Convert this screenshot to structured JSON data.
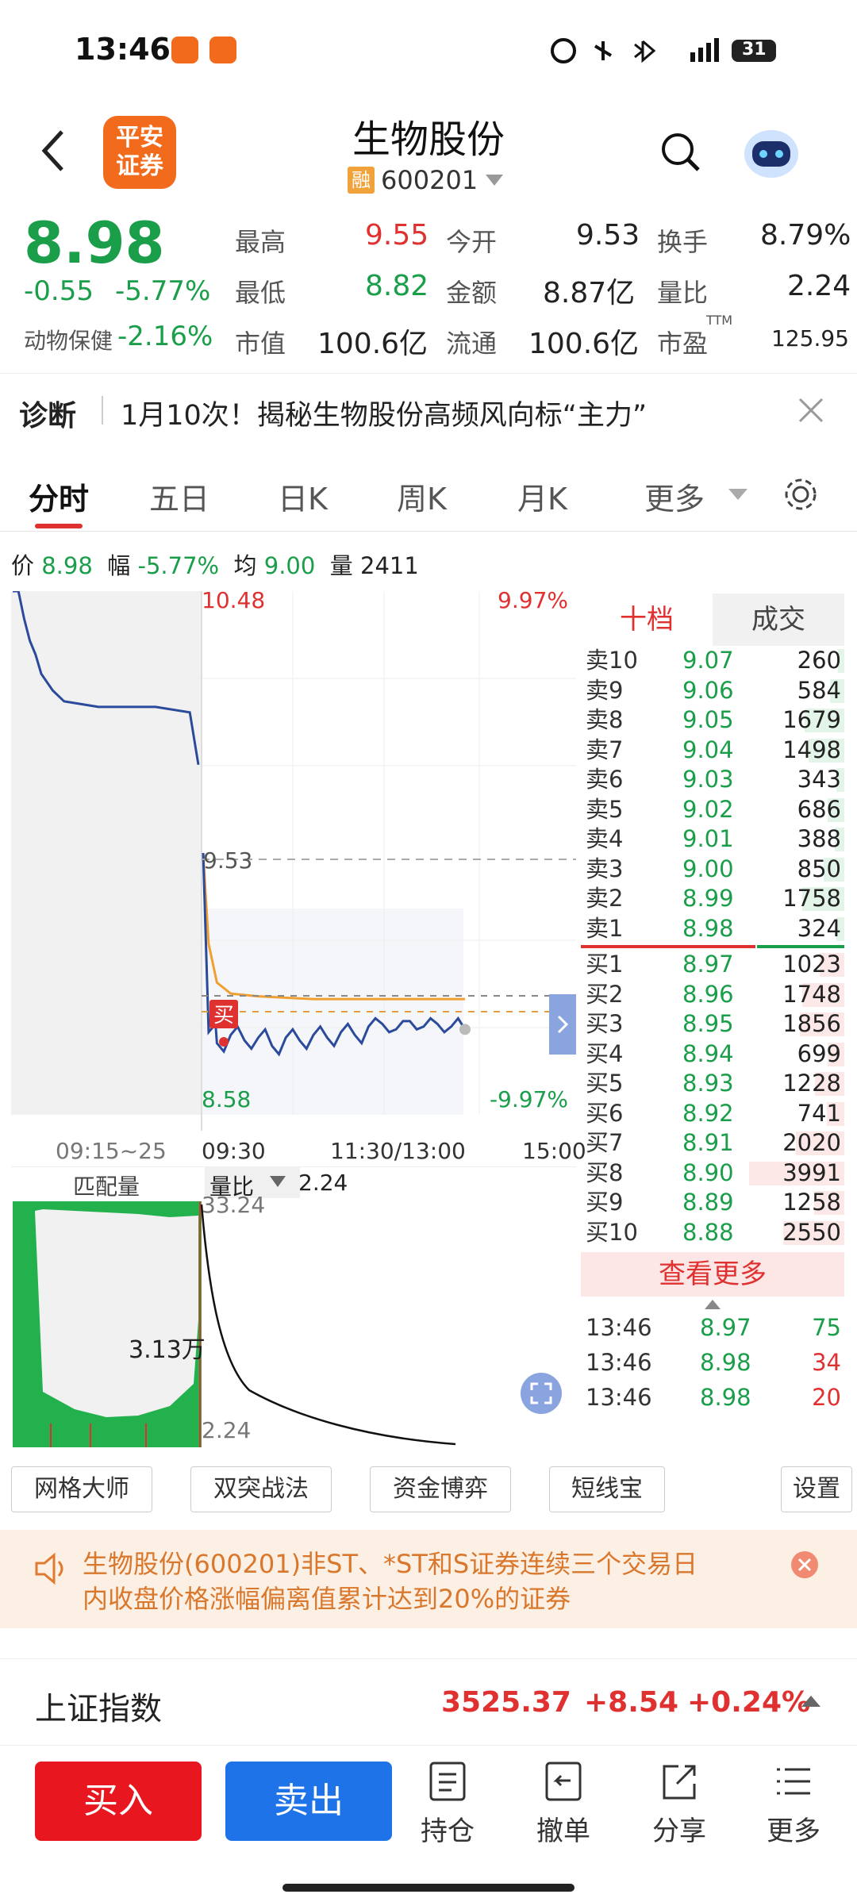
{
  "status_bar": {
    "time": "13:46",
    "battery": "31",
    "network": "4G"
  },
  "header": {
    "logo_text_1": "平安",
    "logo_text_2": "证券",
    "title": "生物股份",
    "margin_tag": "融",
    "code": "600201"
  },
  "quote": {
    "price": "8.98",
    "change": "-0.55",
    "change_pct": "-5.77%",
    "sector_name": "动物保健",
    "sector_pct": "-2.16%",
    "high_label": "最高",
    "high": "9.55",
    "open_label": "今开",
    "open": "9.53",
    "turnover_label": "换手",
    "turnover": "8.79%",
    "low_label": "最低",
    "low": "8.82",
    "amount_label": "金额",
    "amount": "8.87亿",
    "vol_ratio_label": "量比",
    "vol_ratio": "2.24",
    "mktcap_label": "市值",
    "mktcap": "100.6亿",
    "float_label": "流通",
    "float": "100.6亿",
    "pe_label": "市盈",
    "pe_tag": "TTM",
    "pe": "125.95"
  },
  "diagnosis": {
    "label": "诊断",
    "text": "1月10次！揭秘生物股份高频风向标“主力”"
  },
  "tabs": [
    "分时",
    "五日",
    "日K",
    "周K",
    "月K",
    "更多"
  ],
  "info_row": {
    "price_label": "价",
    "price": "8.98",
    "range_label": "幅",
    "range": "-5.77%",
    "avg_label": "均",
    "avg": "9.00",
    "vol_label": "量",
    "vol": "2411"
  },
  "chart_data": {
    "type": "line",
    "title": "",
    "ylim": [
      8.58,
      10.48
    ],
    "y_top_label": "10.48",
    "y_mid_label": "9.53",
    "y_bottom_label": "8.58",
    "pct_top": "9.97%",
    "pct_bottom": "-9.97%",
    "x_labels": [
      "09:15~25",
      "09:30",
      "11:30/13:00",
      "15:00"
    ],
    "buy_marker": "买",
    "auction_series": {
      "name": "",
      "x": [
        0,
        2,
        4,
        6,
        8,
        10,
        14,
        18,
        24,
        30,
        40,
        50,
        62,
        65
      ],
      "values": [
        10.48,
        10.48,
        10.38,
        10.3,
        10.25,
        10.18,
        10.12,
        10.08,
        10.07,
        10.06,
        10.06,
        10.06,
        10.04,
        9.85
      ]
    },
    "price_series": {
      "name": "",
      "x": [
        0,
        2,
        5,
        10,
        15,
        20,
        25,
        30,
        35,
        40,
        45,
        50,
        55,
        60,
        65,
        70,
        75,
        80,
        85,
        90,
        95
      ],
      "values": [
        9.53,
        8.88,
        8.84,
        8.87,
        8.85,
        8.86,
        8.83,
        8.86,
        8.85,
        8.87,
        8.86,
        8.88,
        8.87,
        8.9,
        8.91,
        8.89,
        8.92,
        8.9,
        8.91,
        8.9,
        8.89
      ]
    },
    "avg_series": {
      "name": "",
      "x": [
        0,
        2,
        5,
        10,
        20,
        40,
        60,
        80,
        95
      ],
      "values": [
        9.53,
        9.2,
        9.06,
        9.02,
        9.01,
        9.0,
        9.0,
        9.0,
        9.0
      ]
    }
  },
  "sub_chart": {
    "left_label": "匹配量",
    "right_label": "量比",
    "ratio_value": "2.24",
    "top_value": "33.24",
    "bottom_value": "2.24",
    "match_label": "3.13万"
  },
  "order_book": {
    "tab_active": "十档",
    "tab_other": "成交",
    "asks": [
      {
        "label": "卖10",
        "price": "9.07",
        "vol": "260",
        "ratio": 0.065
      },
      {
        "label": "卖9",
        "price": "9.06",
        "vol": "584",
        "ratio": 0.146
      },
      {
        "label": "卖8",
        "price": "9.05",
        "vol": "1679",
        "ratio": 0.42
      },
      {
        "label": "卖7",
        "price": "9.04",
        "vol": "1498",
        "ratio": 0.375
      },
      {
        "label": "卖6",
        "price": "9.03",
        "vol": "343",
        "ratio": 0.086
      },
      {
        "label": "卖5",
        "price": "9.02",
        "vol": "686",
        "ratio": 0.172
      },
      {
        "label": "卖4",
        "price": "9.01",
        "vol": "388",
        "ratio": 0.097
      },
      {
        "label": "卖3",
        "price": "9.00",
        "vol": "850",
        "ratio": 0.213
      },
      {
        "label": "卖2",
        "price": "8.99",
        "vol": "1758",
        "ratio": 0.44
      },
      {
        "label": "卖1",
        "price": "8.98",
        "vol": "324",
        "ratio": 0.081
      }
    ],
    "bids": [
      {
        "label": "买1",
        "price": "8.97",
        "vol": "1023",
        "ratio": 0.256
      },
      {
        "label": "买2",
        "price": "8.96",
        "vol": "1748",
        "ratio": 0.438
      },
      {
        "label": "买3",
        "price": "8.95",
        "vol": "1856",
        "ratio": 0.465
      },
      {
        "label": "买4",
        "price": "8.94",
        "vol": "699",
        "ratio": 0.175
      },
      {
        "label": "买5",
        "price": "8.93",
        "vol": "1228",
        "ratio": 0.308
      },
      {
        "label": "买6",
        "price": "8.92",
        "vol": "741",
        "ratio": 0.186
      },
      {
        "label": "买7",
        "price": "8.91",
        "vol": "2020",
        "ratio": 0.506
      },
      {
        "label": "买8",
        "price": "8.90",
        "vol": "3991",
        "ratio": 1.0
      },
      {
        "label": "买9",
        "price": "8.89",
        "vol": "1258",
        "ratio": 0.315
      },
      {
        "label": "买10",
        "price": "8.88",
        "vol": "2550",
        "ratio": 0.639
      }
    ],
    "more_label": "查看更多",
    "trades": [
      {
        "time": "13:46",
        "price": "8.97",
        "vol": "75"
      },
      {
        "time": "13:46",
        "price": "8.98",
        "vol": "34"
      },
      {
        "time": "13:46",
        "price": "8.98",
        "vol": "20"
      }
    ]
  },
  "tools": [
    "网格大师",
    "双突战法",
    "资金博弈",
    "短线宝",
    "设置"
  ],
  "notice": {
    "text_1": "生物股份(600201)非ST、*ST和S证券连续三个交易日",
    "text_2": "内收盘价格涨幅偏离值累计达到20%的证券"
  },
  "index": {
    "name": "上证指数",
    "value": "3525.37",
    "change": "+8.54",
    "pct": "+0.24%"
  },
  "bottom": {
    "buy": "买入",
    "sell": "卖出",
    "hold": "持仓",
    "cancel": "撤单",
    "share": "分享",
    "more": "更多"
  },
  "colors": {
    "up": "#e03131",
    "down": "#1a9e4a",
    "line": "#2b4a9b",
    "avg": "#f0a030",
    "brand": "#f26a1b",
    "sell_btn": "#1f73e8",
    "buy_btn": "#e8161f"
  }
}
